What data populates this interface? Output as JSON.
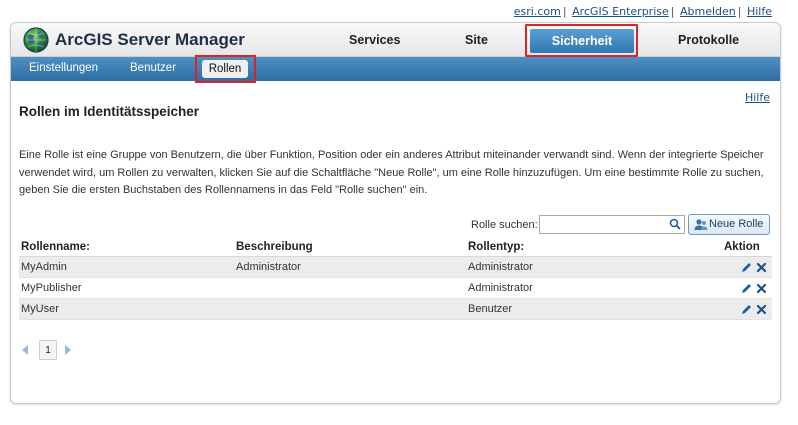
{
  "top_links": {
    "esri": "esri.com",
    "enterprise": "ArcGIS Enterprise",
    "logout": "Abmelden",
    "help": "Hilfe"
  },
  "header": {
    "title": "ArcGIS Server Manager",
    "nav": [
      {
        "label": "Services"
      },
      {
        "label": "Site"
      },
      {
        "label": "Sicherheit",
        "active": true
      },
      {
        "label": "Protokolle"
      }
    ]
  },
  "subnav": {
    "items": [
      {
        "label": "Einstellungen"
      },
      {
        "label": "Benutzer"
      },
      {
        "label": "Rollen",
        "active": true
      }
    ]
  },
  "main": {
    "help": "Hilfe",
    "title": "Rollen im Identitätsspeicher",
    "description": "Eine Rolle ist eine Gruppe von Benutzern, die über Funktion, Position oder ein anderes Attribut miteinander verwandt sind. Wenn der integrierte Speicher verwendet wird, um Rollen zu verwalten, klicken Sie auf die Schaltfläche \"Neue Rolle\", um eine Rolle hinzuzufügen. Um eine bestimmte Rolle zu suchen, geben Sie die ersten Buchstaben des Rollennamens in das Feld \"Rolle suchen\" ein.",
    "search_label": "Rolle suchen:",
    "search_value": "",
    "new_role_label": "Neue Rolle"
  },
  "table": {
    "columns": [
      "Rollenname:",
      "Beschreibung",
      "Rollentyp:",
      "Aktion"
    ],
    "rows": [
      {
        "name": "MyAdmin",
        "description": "Administrator",
        "type": "Administrator"
      },
      {
        "name": "MyPublisher",
        "description": "",
        "type": "Administrator"
      },
      {
        "name": "MyUser",
        "description": "",
        "type": "Benutzer"
      }
    ]
  },
  "pagination": {
    "current_page": "1"
  },
  "colors": {
    "accent": "#2f77b3",
    "highlight": "#d9242a",
    "subnav": "#3b7db3"
  }
}
